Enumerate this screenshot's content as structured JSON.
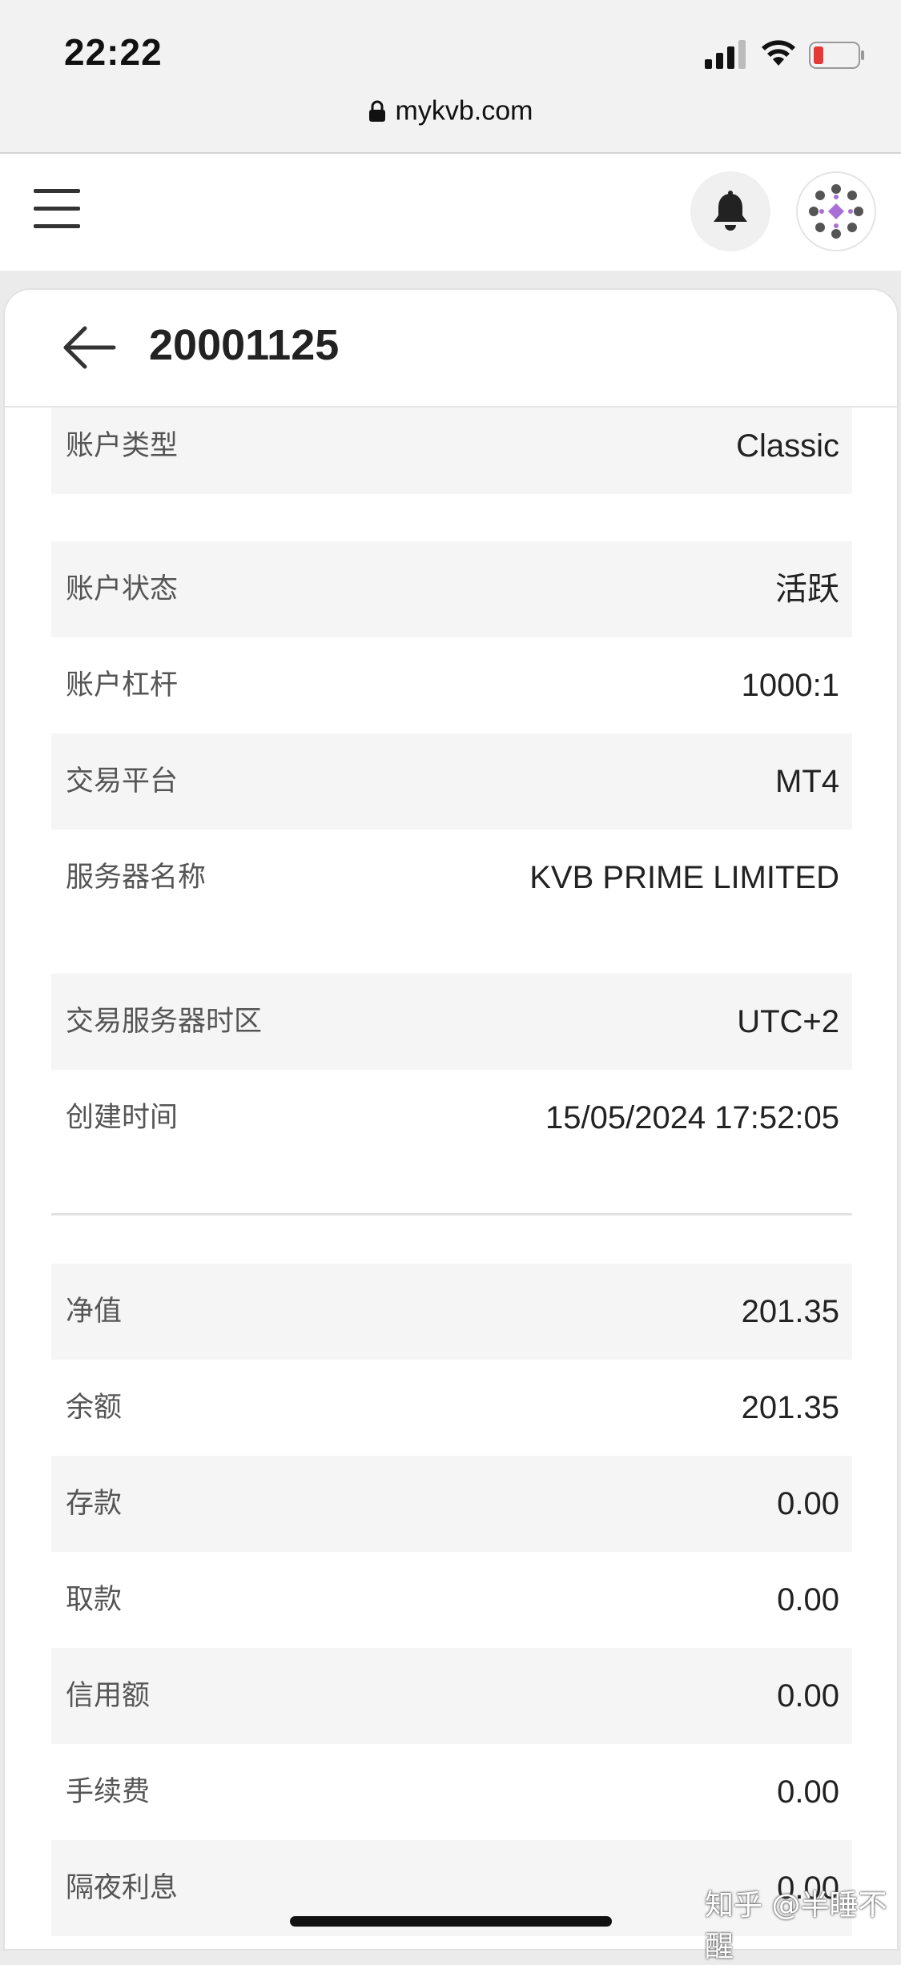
{
  "status_bar": {
    "time": "22:22"
  },
  "browser": {
    "url": "mykvb.com"
  },
  "header": {
    "menu_icon": "hamburger-menu-icon",
    "bell_icon": "bell-icon"
  },
  "account": {
    "title": "20001125"
  },
  "details": [
    {
      "label": "账户类型",
      "value": "Classic"
    },
    {
      "label": "账户状态",
      "value": "活跃"
    },
    {
      "label": "账户杠杆",
      "value": "1000:1"
    },
    {
      "label": "交易平台",
      "value": "MT4"
    },
    {
      "label": "服务器名称",
      "value": "KVB PRIME LIMITED"
    },
    {
      "label": "交易服务器时区",
      "value": "UTC+2"
    },
    {
      "label": "创建时间",
      "value": "15/05/2024 17:52:05"
    }
  ],
  "balances": [
    {
      "label": "净值",
      "value": "201.35"
    },
    {
      "label": "余额",
      "value": "201.35"
    },
    {
      "label": "存款",
      "value": "0.00"
    },
    {
      "label": "取款",
      "value": "0.00"
    },
    {
      "label": "信用额",
      "value": "0.00"
    },
    {
      "label": "手续费",
      "value": "0.00"
    },
    {
      "label": "隔夜利息",
      "value": "0.00"
    }
  ],
  "watermark": "知乎 @半睡不醒",
  "colors": {
    "battery_low": "#e53935",
    "avatar_accent": "#a86fd6"
  }
}
